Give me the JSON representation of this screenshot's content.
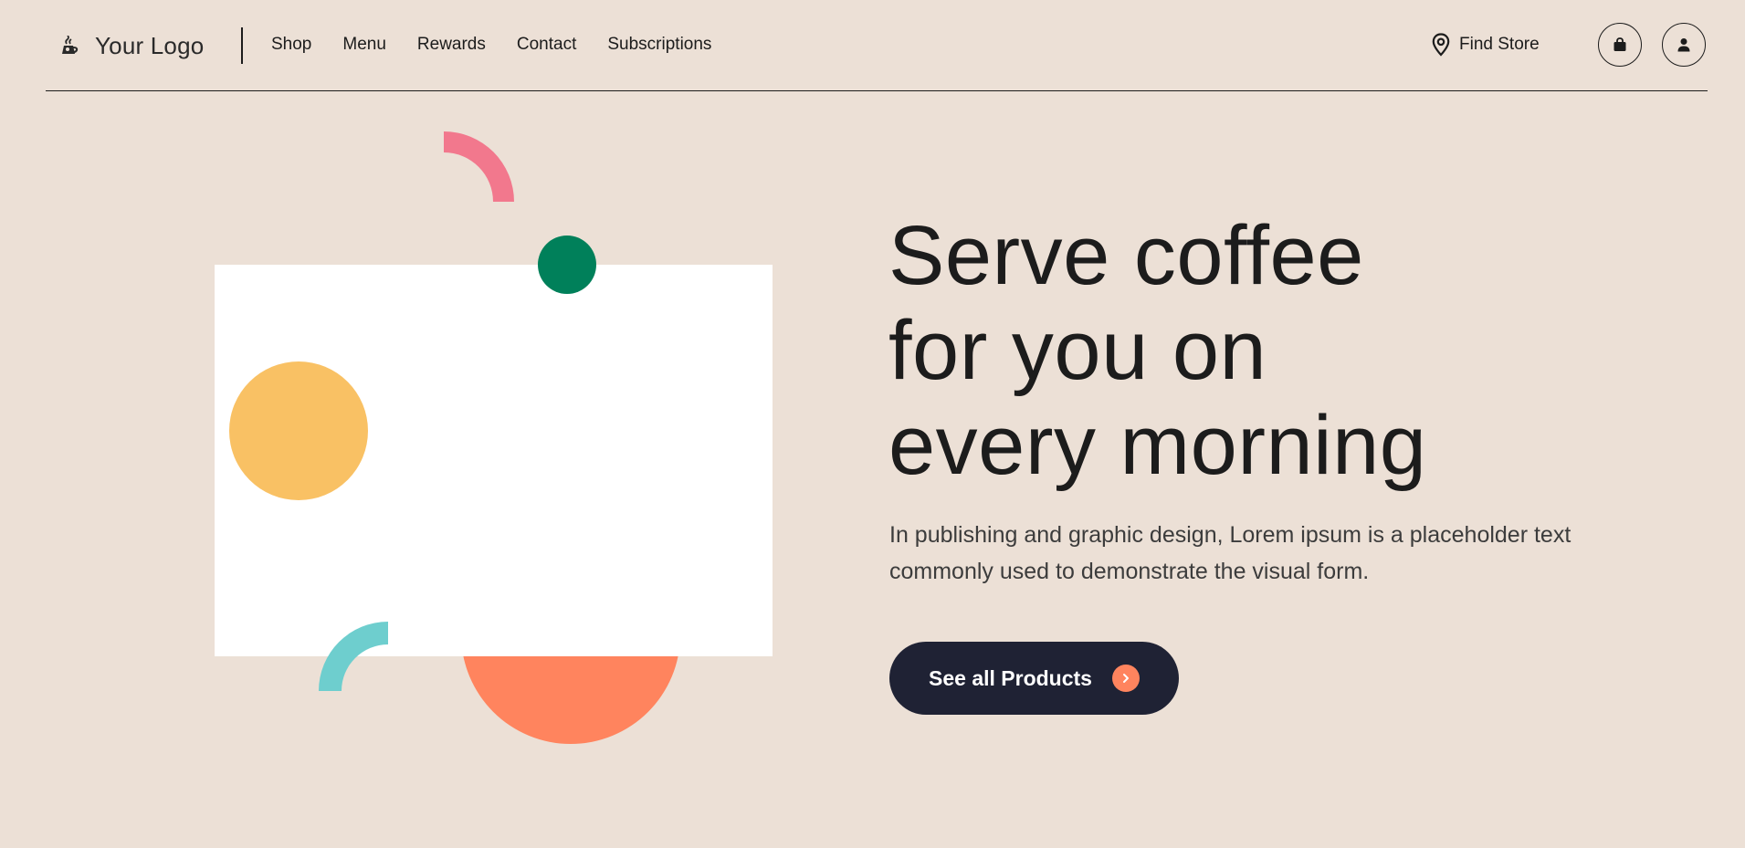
{
  "brand": {
    "logo_text": "Your Logo"
  },
  "nav": {
    "items": [
      {
        "label": "Shop"
      },
      {
        "label": "Menu"
      },
      {
        "label": "Rewards"
      },
      {
        "label": "Contact"
      },
      {
        "label": "Subscriptions"
      }
    ]
  },
  "header_actions": {
    "find_store_label": "Find Store",
    "find_store_icon": "map-pin-icon",
    "bag_icon": "shopping-bag-icon",
    "user_icon": "user-icon"
  },
  "hero": {
    "title_lines": [
      "Serve coffee",
      "for you on",
      "every morning"
    ],
    "subtitle": "In publishing and graphic design, Lorem ipsum is a placeholder text commonly used to demonstrate the visual form.",
    "cta_label": "See all Products",
    "cta_icon": "chevron-right-icon"
  },
  "colors": {
    "background": "#ece0d6",
    "dark": "#1f2234",
    "accent_orange": "#ff845e",
    "accent_green": "#00805a",
    "accent_yellow": "#f9c164",
    "accent_pink": "#f2788d",
    "accent_teal": "#6ecece"
  }
}
